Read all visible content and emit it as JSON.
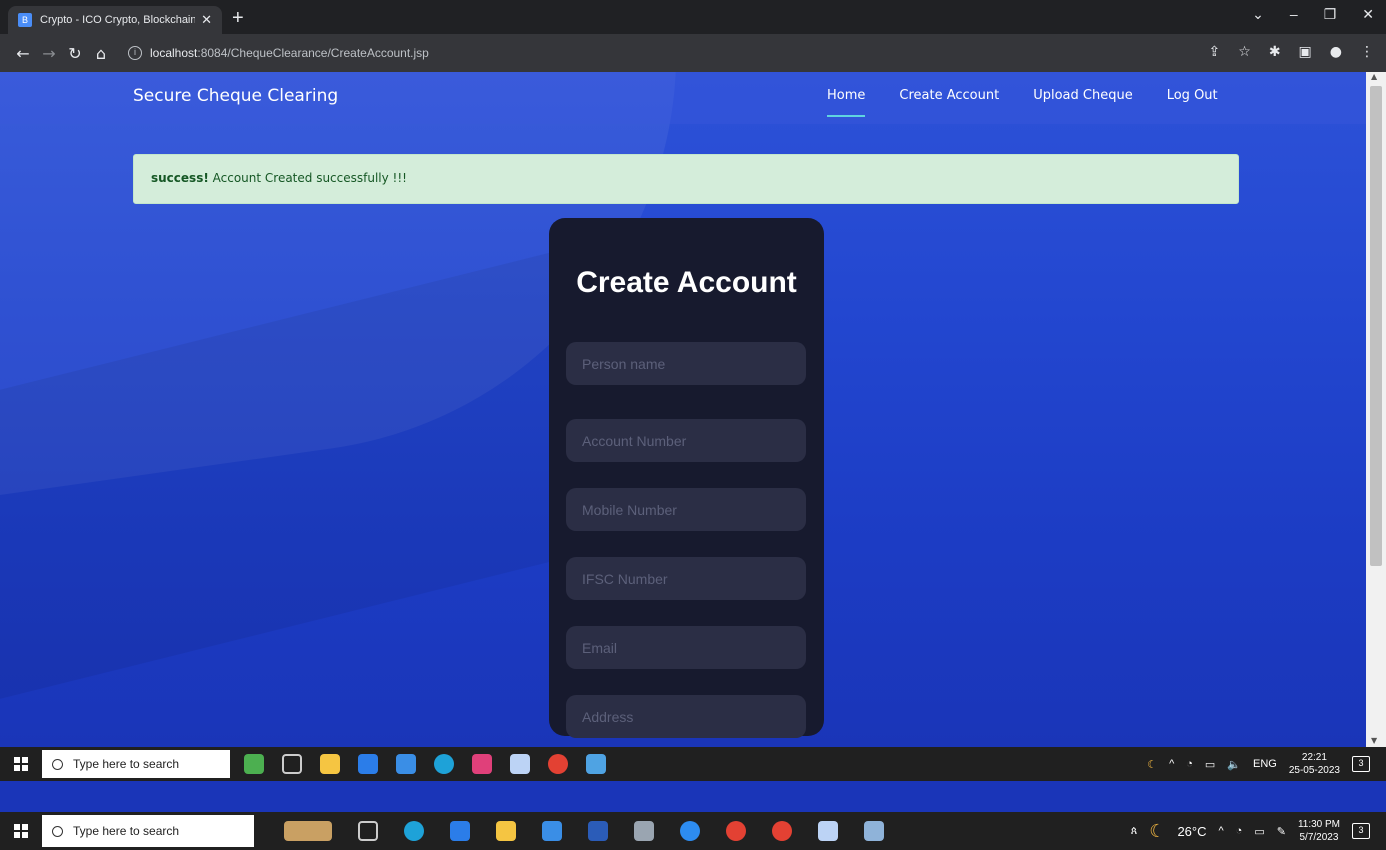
{
  "browser": {
    "tab_title": "Crypto - ICO Crypto, Blockchain",
    "tab_favicon": "B",
    "url_host": "localhost",
    "url_rest": ":8084/ChequeClearance/CreateAccount.jsp"
  },
  "site": {
    "brand": "Secure Cheque Clearing",
    "menu": [
      "Home",
      "Create Account",
      "Upload Cheque",
      "Log Out"
    ],
    "alert_strong": "success!",
    "alert_text": " Account Created successfully !!!",
    "form_title": "Create Account",
    "placeholders": [
      "Person name",
      "Account Number",
      "Mobile Number",
      "IFSC Number",
      "Email",
      "Address"
    ]
  },
  "taskbar_inner": {
    "search_text": "Type here to search",
    "lang": "ENG",
    "time": "22:21",
    "date": "25-05-2023",
    "notif_count": "3"
  },
  "taskbar_outer": {
    "search_text": "Type here to search",
    "temp": "26°C",
    "time": "11:30 PM",
    "date": "5/7/2023",
    "notif_count": "3"
  },
  "colors": {
    "accent": "#5fd4e0",
    "alert_bg": "#d4edda",
    "card_bg": "#171a2e"
  }
}
